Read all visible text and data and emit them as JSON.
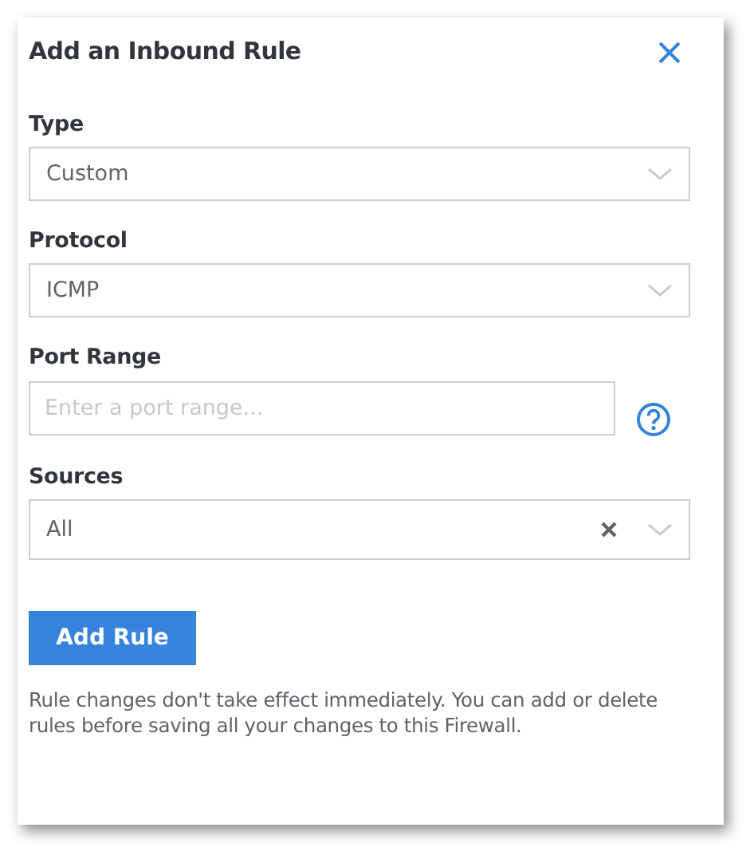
{
  "dialog": {
    "title": "Add an Inbound Rule"
  },
  "fields": [
    {
      "label": "Type",
      "kind": "select",
      "value": "Custom",
      "help": false,
      "clearable": false
    },
    {
      "label": "Protocol",
      "kind": "select",
      "value": "ICMP",
      "help": false,
      "clearable": false
    },
    {
      "label": "Port Range",
      "kind": "input",
      "placeholder": "Enter a port range...",
      "help": true,
      "clearable": false
    },
    {
      "label": "Sources",
      "kind": "select",
      "value": "All",
      "help": false,
      "clearable": true
    }
  ],
  "button": "Add Rule",
  "note": "Rule changes don't take effect immediately. You can add or delete rules before saving all your changes to this Firewall."
}
